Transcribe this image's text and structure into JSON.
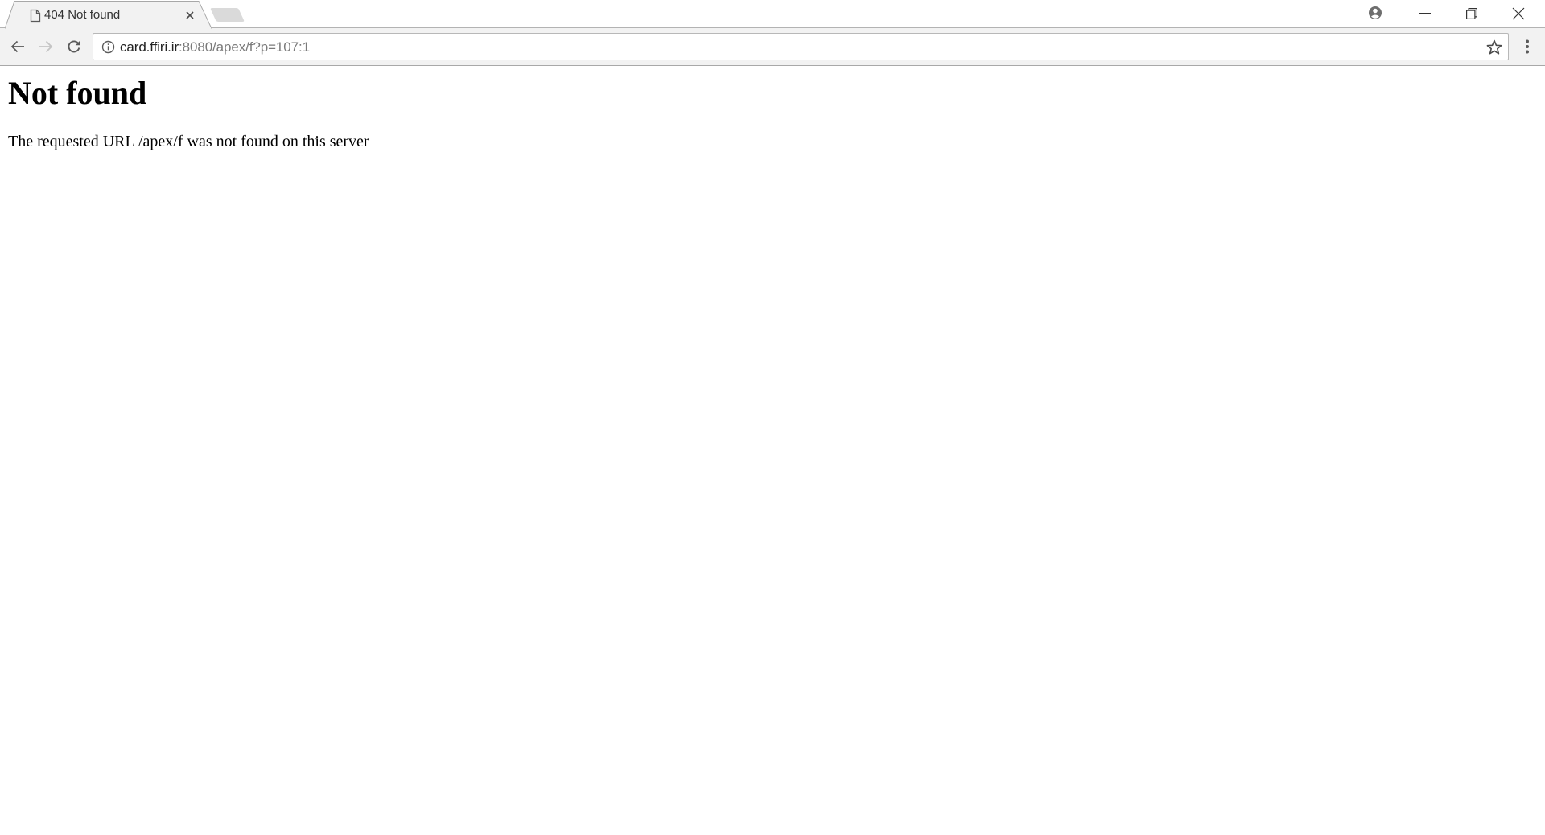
{
  "browser": {
    "tabs": [
      {
        "title": "404 Not found",
        "icon": "page-icon",
        "active": true
      }
    ],
    "new_tab_icon": "new-tab-icon",
    "window_controls": {
      "profile_icon": "profile-icon",
      "minimize_icon": "minimize-icon",
      "restore_icon": "restore-icon",
      "close_icon": "close-icon"
    },
    "toolbar": {
      "back_icon": "back-arrow-icon",
      "forward_icon": "forward-arrow-icon",
      "reload_icon": "reload-icon",
      "menu_icon": "kebab-menu-icon"
    },
    "omnibox": {
      "security_icon": "info-icon",
      "url_host": "card.ffiri.ir",
      "url_rest": ":8080/apex/f?p=107:1",
      "bookmark_icon": "star-icon"
    }
  },
  "page": {
    "heading": "Not found",
    "message": "The requested URL /apex/f was not found on this server"
  },
  "colors": {
    "toolbar_bg": "#f2f2f2",
    "tab_bg": "#f2f2f2",
    "url_host": "#222222",
    "url_rest": "#7a7a7a"
  }
}
